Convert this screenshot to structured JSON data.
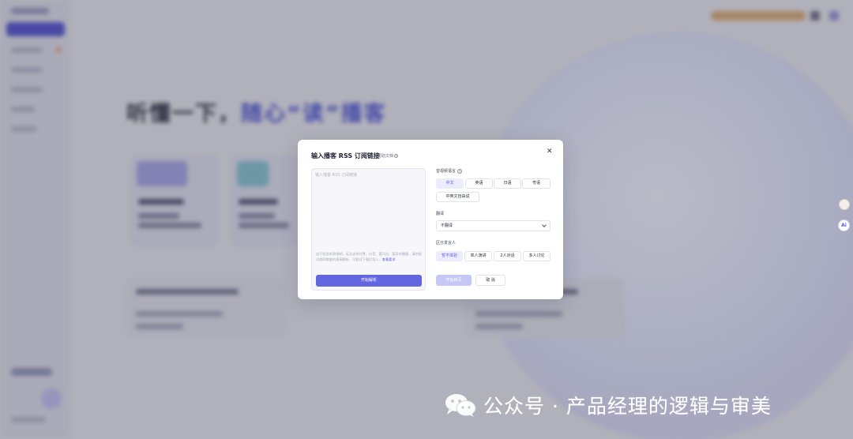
{
  "background": {
    "hero_title_part1": "听懂一下，",
    "hero_title_part2": "随心“读”播客"
  },
  "modal": {
    "title": "输入播客 RSS 订阅链接",
    "help_link": "帮助文档",
    "close_icon": "close-icon",
    "input_placeholder": "输入播客 RSS 订阅链接",
    "hint_text": "由于版务条款限制，无法支持付费、抖音、喜马拉、爱奇的播客，请勿尝试相同数据的直接解析，可尝试下载后导入，",
    "hint_link": "查看要求",
    "parse_button": "开始解析",
    "language_label": "音视频语言",
    "languages": [
      "中文",
      "英语",
      "日语",
      "粤语",
      "中英文自由说"
    ],
    "language_selected": "中文",
    "translate_label": "翻译",
    "translate_value": "不翻译",
    "speaker_label": "区分发言人",
    "speakers": [
      "暂不体验",
      "单人演讲",
      "2人对话",
      "多人讨论"
    ],
    "speaker_selected": "暂不体验",
    "start_button": "开始转写",
    "cancel_button": "取 消"
  },
  "floating": {
    "ai_badge": "Ai"
  },
  "watermark": {
    "text": "公众号 · 产品经理的逻辑与审美"
  },
  "colors": {
    "primary": "#6366e1",
    "primary_disabled": "#c6c7f4",
    "chip_selected_bg": "#ececfd"
  }
}
